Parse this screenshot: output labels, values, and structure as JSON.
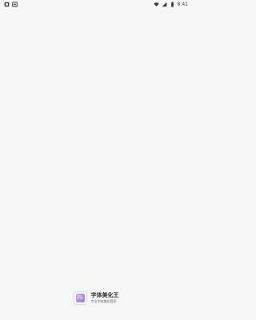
{
  "status_bar": {
    "time": "8:41",
    "left_icons": [
      "notification-icon",
      "battery-saver-icon"
    ],
    "right_icons": [
      "wifi-icon",
      "signal-icon",
      "battery-icon"
    ]
  },
  "splash": {
    "app_name": "字体美化王",
    "slogan": "专业字体美化管家",
    "logo_glyph": "Fo",
    "accent_color": "#9a7ad8"
  }
}
